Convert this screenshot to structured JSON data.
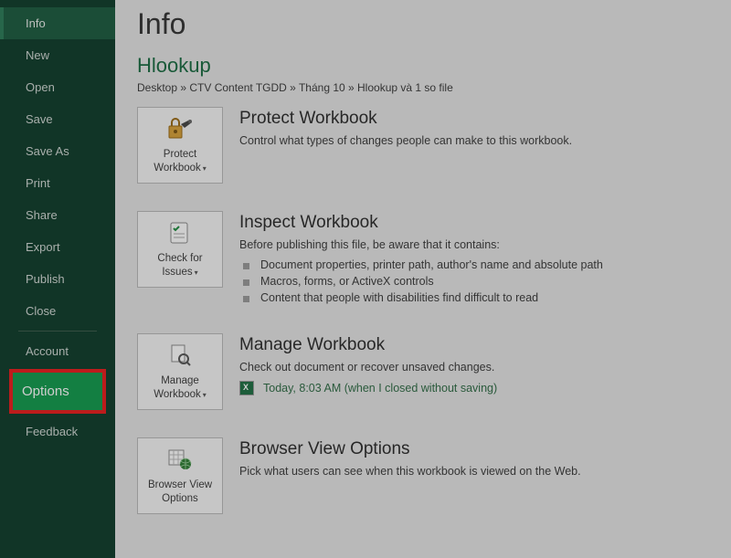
{
  "sidebar": {
    "items": [
      {
        "label": "Info"
      },
      {
        "label": "New"
      },
      {
        "label": "Open"
      },
      {
        "label": "Save"
      },
      {
        "label": "Save As"
      },
      {
        "label": "Print"
      },
      {
        "label": "Share"
      },
      {
        "label": "Export"
      },
      {
        "label": "Publish"
      },
      {
        "label": "Close"
      }
    ],
    "account": "Account",
    "options": "Options",
    "feedback": "Feedback"
  },
  "main": {
    "title": "Info",
    "doc_name": "Hlookup",
    "breadcrumb": "Desktop » CTV Content TGDD » Tháng 10 » Hlookup và 1 so file",
    "sections": {
      "protect": {
        "tile": "Protect Workbook",
        "title": "Protect Workbook",
        "desc": "Control what types of changes people can make to this workbook."
      },
      "inspect": {
        "tile": "Check for Issues",
        "title": "Inspect Workbook",
        "desc": "Before publishing this file, be aware that it contains:",
        "bullets": [
          "Document properties, printer path, author's name and absolute path",
          "Macros, forms, or ActiveX controls",
          "Content that people with disabilities find difficult to read"
        ]
      },
      "manage": {
        "tile": "Manage Workbook",
        "title": "Manage Workbook",
        "desc": "Check out document or recover unsaved changes.",
        "version": "Today, 8:03 AM (when I closed without saving)"
      },
      "browser": {
        "tile": "Browser View Options",
        "title": "Browser View Options",
        "desc": "Pick what users can see when this workbook is viewed on the Web."
      }
    }
  }
}
